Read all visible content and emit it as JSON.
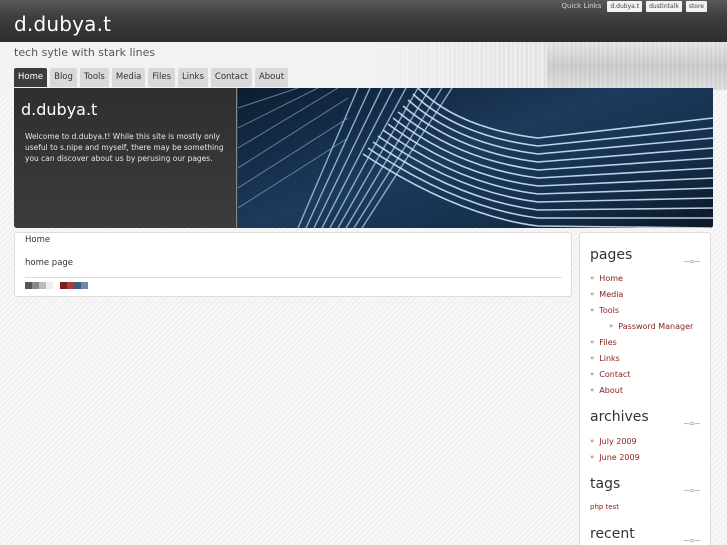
{
  "header": {
    "site_title": "d.dubya.t",
    "tagline": "tech sytle with stark lines",
    "quick_links_label": "Quick Links",
    "quick_links": [
      "d.dubya.t",
      "dustintalk",
      "store"
    ]
  },
  "nav": {
    "tabs": [
      "Home",
      "Blog",
      "Tools",
      "Media",
      "Files",
      "Links",
      "Contact",
      "About"
    ],
    "active": "Home"
  },
  "hero": {
    "title": "d.dubya.t",
    "text": "Welcome to d.dubya.t! While this site is mostly only useful to s.nipe and myself, there may be something you can discover about us by perusing our pages."
  },
  "content": {
    "breadcrumb": "Home",
    "heading": "home page",
    "swatch_colors": [
      "#555555",
      "#888888",
      "#bbbbbb",
      "#eeeeee",
      "#7a1f1f",
      "#b03a3a",
      "#3f5a7a",
      "#6a8aaa"
    ]
  },
  "sidebar": {
    "pages_heading": "pages",
    "pages": [
      {
        "label": "Home",
        "sub": false
      },
      {
        "label": "Media",
        "sub": false
      },
      {
        "label": "Tools",
        "sub": false
      },
      {
        "label": "Password Manager",
        "sub": true
      },
      {
        "label": "Files",
        "sub": false
      },
      {
        "label": "Links",
        "sub": false
      },
      {
        "label": "Contact",
        "sub": false
      },
      {
        "label": "About",
        "sub": false
      }
    ],
    "archives_heading": "archives",
    "archives": [
      "July 2009",
      "June 2009"
    ],
    "tags_heading": "tags",
    "tags": "php test",
    "recent_heading": "recent",
    "bullet": "»",
    "flourish": "~∞~"
  }
}
